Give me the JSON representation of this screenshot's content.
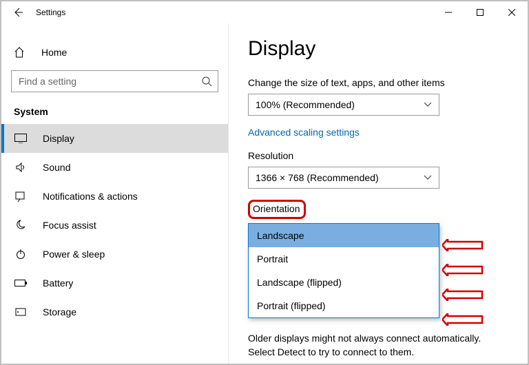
{
  "window": {
    "title": "Settings"
  },
  "sidebar": {
    "home_label": "Home",
    "search_placeholder": "Find a setting",
    "category": "System",
    "items": [
      {
        "label": "Display"
      },
      {
        "label": "Sound"
      },
      {
        "label": "Notifications & actions"
      },
      {
        "label": "Focus assist"
      },
      {
        "label": "Power & sleep"
      },
      {
        "label": "Battery"
      },
      {
        "label": "Storage"
      }
    ]
  },
  "main": {
    "title": "Display",
    "scale_label": "Change the size of text, apps, and other items",
    "scale_value": "100% (Recommended)",
    "advanced_scaling": "Advanced scaling settings",
    "resolution_label": "Resolution",
    "resolution_value": "1366 × 768 (Recommended)",
    "orientation_label": "Orientation",
    "orientation_options": [
      "Landscape",
      "Portrait",
      "Landscape (flipped)",
      "Portrait (flipped)"
    ],
    "footer_text": "Older displays might not always connect automatically. Select Detect to try to connect to them."
  }
}
